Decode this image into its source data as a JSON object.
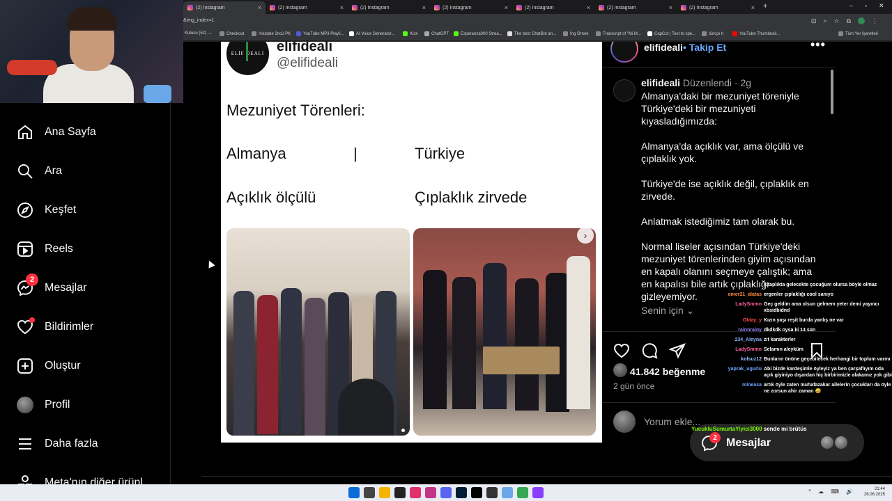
{
  "browser": {
    "tabs": [
      {
        "title": "(2) Instagram"
      },
      {
        "title": "(2) Instagram"
      },
      {
        "title": "(2) Instagram"
      },
      {
        "title": "(2) Instagram"
      },
      {
        "title": "(2) Instagram"
      },
      {
        "title": "(2) Instagram"
      },
      {
        "title": "(2) Instagram"
      }
    ],
    "url": "&img_index=1",
    "bookmarks": [
      "Kutusu (52) -...",
      "Checkout",
      "Youtube 3ncü PK",
      "YouTube MP3 Playli...",
      "AI Voice Generator...",
      "Kick",
      "ChatGPT",
      "Esperanza000 Strea...",
      "The best ChatBot an...",
      "İng Örnek",
      "Transcript of \"Mi M...",
      "CapCut | Text to spe...",
      "türkçe h",
      "YouTube Thumbnail..."
    ],
    "all_bookmarks": "Tüm Yer İşaretleri",
    "profile_initial": "U"
  },
  "nav": {
    "items": [
      {
        "label": "Ana Sayfa",
        "icon": "home-icon"
      },
      {
        "label": "Ara",
        "icon": "search-icon"
      },
      {
        "label": "Keşfet",
        "icon": "compass-icon"
      },
      {
        "label": "Reels",
        "icon": "reels-icon"
      },
      {
        "label": "Mesajlar",
        "icon": "messenger-icon",
        "badge": "2"
      },
      {
        "label": "Bildirimler",
        "icon": "heart-icon"
      },
      {
        "label": "Oluştur",
        "icon": "plus-square-icon"
      },
      {
        "label": "Profil",
        "icon": "avatar"
      },
      {
        "label": "Daha fazla",
        "icon": "menu-icon"
      },
      {
        "label": "Meta'nın diğer ürünl",
        "icon": "meta-icon"
      }
    ]
  },
  "post": {
    "tweet": {
      "name": "elifideali",
      "handle": "@elifideali",
      "logo_text": "ELİF DEALİ",
      "heading": "Mezuniyet Törenleri:",
      "col_left_1": "Almanya",
      "separator": "|",
      "col_right_1": "Türkiye",
      "col_left_2": "Açıklık ölçülü",
      "col_right_2": "Çıplaklık zirvede"
    },
    "username": "elifideali",
    "follow": "Takip Et",
    "caption": {
      "edited": "Düzenlendi",
      "age": "2g",
      "paragraphs": [
        "Almanya'daki bir mezuniyet töreniyle Türkiye'deki bir mezuniyeti kıyasladığımızda:",
        "Almanya'da açıklık var, ama ölçülü ve çıplaklık yok.",
        "Türkiye'de ise açıklık değil, çıplaklık en zirvede.",
        "Anlatmak istediğimiz tam olarak bu.",
        "Normal liseler açısından Türkiye'deki mezuniyet törenlerinden giyim açısından en kapalı olanını seçmeye çalıştık; ama en kapalısı bile artık çıplaklığı gizleyemiyor."
      ]
    },
    "for_you": "Senin için",
    "likes": "41.842 beğenme",
    "time": "2 gün önce",
    "comment_placeholder": "Yorum ekle..."
  },
  "chat": [
    {
      "user": "",
      "msg": "kitaplıkta gelecekte çocuğum olursa böyle olmaz",
      "color": "#ff6b6b"
    },
    {
      "user": "omer21_alatas",
      "msg": "ergenler çıplaklığı cool sanıyo",
      "color": "#ff8c42"
    },
    {
      "user": "LadySmmn",
      "msg": "Geç geldim ama olsun gelmem yeter demi yayıncı xbsidbidnd",
      "color": "#ff5fa2"
    },
    {
      "user": "Oktay_y",
      "msg": "Kızın yaşı reşit burda yanlış ne var",
      "color": "#ff4d4d"
    },
    {
      "user": "rainnrainy",
      "msg": "dkdkdk oysa ki 14 sün",
      "color": "#9b7dff"
    },
    {
      "user": "234_Aleyna",
      "msg": "zit karakterler",
      "color": "#8ab4ff"
    },
    {
      "user": "LadySmmn",
      "msg": "Selamın aleyküm",
      "color": "#ff5fa2"
    },
    {
      "user": "kolsuz12",
      "msg": "Bunların önüne geçebilecek herhangi bir toplum varmı",
      "color": "#9fc5ff"
    },
    {
      "user": "yaprak_ugurlu",
      "msg": "Abi bizde kardeşimle öyleyiz ya ben çarşaflıyım oda açık giyiniyo dışardan hiç birbirimizle alakamız yok gibi",
      "color": "#6fa8ff"
    },
    {
      "user": "mineasa",
      "msg": "artık öyle zaten muhafazakar ailelerin çocukları da öyle ne zorsun ahir zaman 😅",
      "color": "#6fa8ff"
    },
    {
      "user": "YucukluSumurtaYiyici3000",
      "msg": "sende mi brütüs",
      "color": "#7CFC00"
    }
  ],
  "messages_pill": {
    "label": "Mesajlar",
    "badge": "2"
  },
  "taskbar": {
    "time": "21:44",
    "date": "26.06.2025"
  }
}
